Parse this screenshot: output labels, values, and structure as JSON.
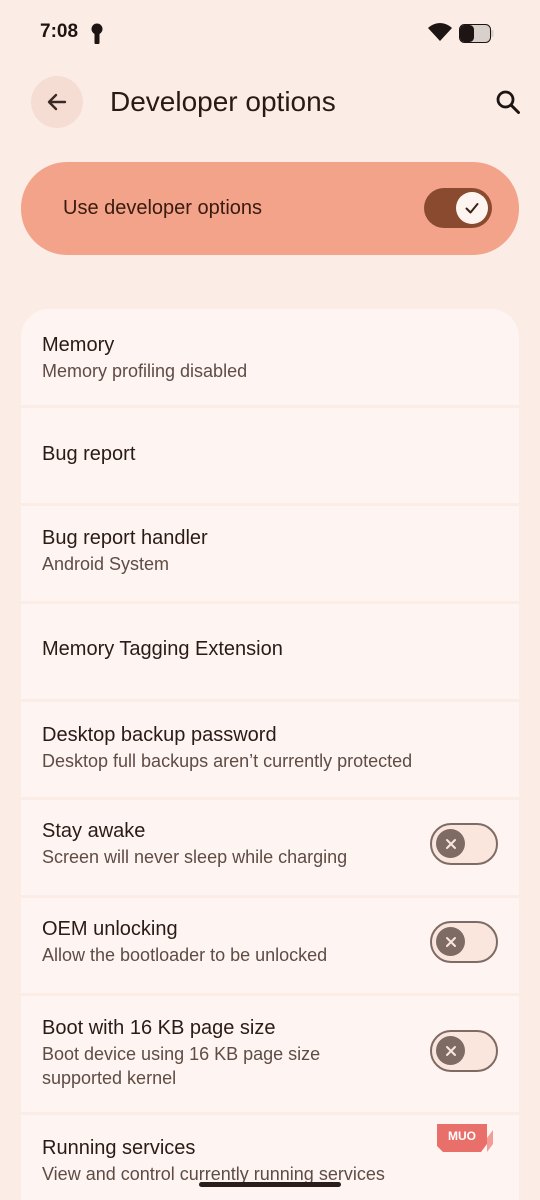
{
  "status_bar": {
    "time": "7:08",
    "icons": [
      "key-icon",
      "wifi-icon",
      "battery-icon"
    ]
  },
  "app_bar": {
    "title": "Developer options",
    "back_icon": "arrow-back-icon",
    "search_icon": "search-icon"
  },
  "master_switch": {
    "label": "Use developer options",
    "checked": true
  },
  "settings": [
    {
      "title": "Memory",
      "subtitle": "Memory profiling disabled"
    },
    {
      "title": "Bug report"
    },
    {
      "title": "Bug report handler",
      "subtitle": "Android System"
    },
    {
      "title": "Memory Tagging Extension"
    },
    {
      "title": "Desktop backup password",
      "subtitle": "Desktop full backups aren’t currently protected"
    },
    {
      "title": "Stay awake",
      "subtitle": "Screen will never sleep while charging",
      "toggle": false
    },
    {
      "title": "OEM unlocking",
      "subtitle": "Allow the bootloader to be unlocked",
      "toggle": false
    },
    {
      "title": "Boot with 16 KB page size",
      "subtitle": "Boot device using 16 KB page size supported kernel",
      "toggle": false
    },
    {
      "title": "Running services",
      "subtitle": "View and control currently running services"
    }
  ],
  "watermark": {
    "text": "MUO"
  },
  "colors": {
    "background": "#fcece6",
    "master_card": "#f2a389",
    "toggle_on": "#8a4a30",
    "row_background": "#fef4f1",
    "toggle_off_outline": "#7e6b64"
  }
}
